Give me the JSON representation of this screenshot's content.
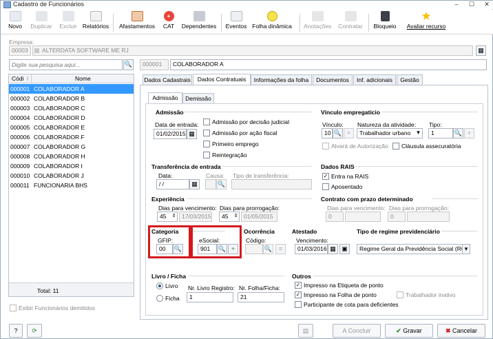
{
  "window": {
    "title": "Cadastro de Funcionários"
  },
  "toolbar": {
    "novo": "Novo",
    "duplicar": "Duplicar",
    "excluir": "Excluir",
    "relatorios": "Relatórios",
    "afastamentos": "Afastamentos",
    "cat": "CAT",
    "dependentes": "Dependentes",
    "eventos": "Eventos",
    "folha": "Folha dinâmica",
    "anotacoes": "Anotações",
    "contratar": "Contratar",
    "bloqueio": "Bloqueio",
    "avaliar": "Avaliar recurso"
  },
  "empresa": {
    "label": "Empresa:",
    "code": "00003",
    "name": "ALTERDATA SOFTWARE ME RJ"
  },
  "search": {
    "placeholder": "Digite sua pesquisa aqui..."
  },
  "employee": {
    "code": "000001",
    "name": "COLABORADOR A"
  },
  "list": {
    "col_code": "Códi",
    "col_name": "Nome",
    "rows": [
      {
        "code": "000001",
        "name": "COLABORADOR A"
      },
      {
        "code": "000002",
        "name": "COLABORADOR B"
      },
      {
        "code": "000003",
        "name": "COLABORADOR C"
      },
      {
        "code": "000004",
        "name": "COLABORADOR D"
      },
      {
        "code": "000005",
        "name": "COLABORADOR E"
      },
      {
        "code": "000006",
        "name": "COLABORADOR F"
      },
      {
        "code": "000007",
        "name": "COLABORADOR G"
      },
      {
        "code": "000008",
        "name": "COLABORADOR H"
      },
      {
        "code": "000009",
        "name": "COLABORADOR I"
      },
      {
        "code": "000010",
        "name": "COLABORADOR J"
      },
      {
        "code": "000011",
        "name": "FUNCIONARIA BHS"
      }
    ],
    "total": "Total: 11",
    "show_fired": "Exibir Funcionários demitidos"
  },
  "tabs": [
    "Dados Cadastrais",
    "Dados Contratuais",
    "Informações da folha",
    "Documentos",
    "Inf. adicionais",
    "Gestão"
  ],
  "subtabs": [
    "Admissão",
    "Demissão"
  ],
  "admissao": {
    "title": "Admissão",
    "date_label": "Data de entrada:",
    "date": "01/02/2015",
    "opt1": "Admissão por decisão judicial",
    "opt2": "Admissão por ação fiscal",
    "opt3": "Primeiro emprego",
    "opt4": "Reintegração"
  },
  "vinculo": {
    "title": "Vínculo empregatício",
    "vinculo_label": "Vínculo:",
    "vinculo_val": "10",
    "natureza_label": "Natureza da atividade:",
    "natureza_val": "Trabalhador urbano",
    "tipo_label": "Tipo:",
    "tipo_val": "1",
    "alvara": "Alvará de Autorização",
    "clausula": "Cláusula assecuratória"
  },
  "transferencia": {
    "title": "Transferência de entrada",
    "data_label": "Data:",
    "data_val": "/ /",
    "causa_label": "Causa:",
    "tipo_label": "Tipo de transferência:"
  },
  "rais": {
    "title": "Dados RAIS",
    "entra": "Entra na RAIS",
    "aposentado": "Aposentado"
  },
  "experiencia": {
    "title": "Experiência",
    "venc_label": "Dias para vencimento:",
    "venc_days": "45",
    "venc_date": "17/03/2015",
    "prorr_label": "Dias para prorrogação:",
    "prorr_days": "45",
    "prorr_date": "01/05/2015"
  },
  "contrato": {
    "title": "Contrato com prazo determinado",
    "venc_label": "Dias para vencimento:",
    "venc_days": "0",
    "prorr_label": "Dias para prorrogação:",
    "prorr_days": "0"
  },
  "categoria": {
    "title": "Categoria",
    "gfip_label": "GFIP:",
    "gfip_val": "00",
    "esocial_label": "eSocial:",
    "esocial_val": "901"
  },
  "ocorrencia": {
    "title": "Ocorrência",
    "codigo_label": "Código:"
  },
  "atestado": {
    "title": "Atestado",
    "venc_label": "Vencimento:",
    "venc_val": "01/03/2016"
  },
  "regime": {
    "title": "Tipo de regime previdenciário",
    "val": "Regime Geral da Previdência Social (RGP"
  },
  "livro": {
    "title": "Livro / Ficha",
    "livro": "Livro",
    "ficha": "Ficha",
    "nr_livro_label": "Nr. Livro Registro:",
    "nr_livro_val": "1",
    "nr_folha_label": "Nr. Folha/Ficha:",
    "nr_folha_val": "21"
  },
  "outros": {
    "title": "Outros",
    "opt1": "Impresso na Etiqueta de ponto",
    "opt2": "Impresso na Folha de ponto",
    "opt3": "Trabalhador inativo",
    "opt4": "Participante de cota para deficientes"
  },
  "buttons": {
    "help": "?",
    "concluir": "A Concluir",
    "gravar": "Gravar",
    "cancelar": "Cancelar"
  },
  "colors": {
    "accent": "#3399ff",
    "highlight": "#d3191c"
  }
}
